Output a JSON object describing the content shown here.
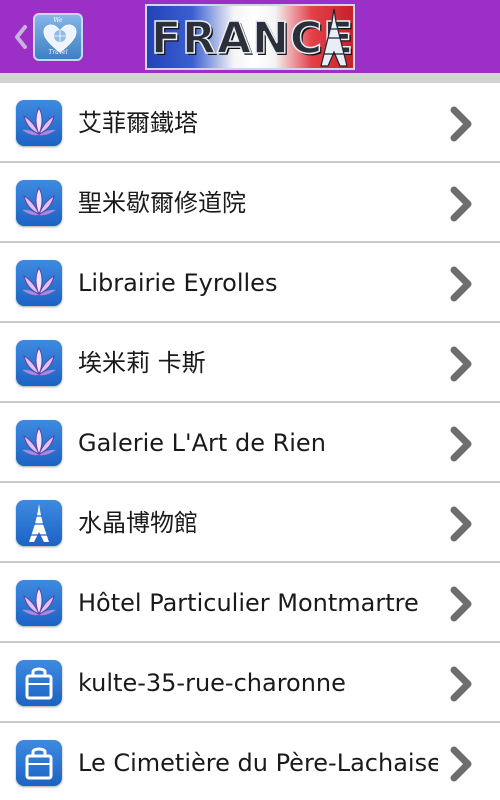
{
  "app_bar": {
    "background": "#9b2fc6",
    "back_icon": "chevron-left-icon",
    "logo": {
      "top_text": "We",
      "bottom_text": "Travel",
      "icon": "heart-globe-icon"
    },
    "title": "FRANCE",
    "title_icon": "eiffel-tower-icon"
  },
  "list": {
    "items": [
      {
        "label": "艾菲爾鐵塔",
        "icon": "lotus-icon"
      },
      {
        "label": "聖米歇爾修道院",
        "icon": "lotus-icon"
      },
      {
        "label": "Librairie Eyrolles",
        "icon": "lotus-icon"
      },
      {
        "label": "埃米莉 卡斯",
        "icon": "lotus-icon"
      },
      {
        "label": "Galerie L'Art de Rien",
        "icon": "lotus-icon"
      },
      {
        "label": "水晶博物館",
        "icon": "eiffel-tower-icon"
      },
      {
        "label": "Hôtel Particulier Montmartre",
        "icon": "lotus-icon"
      },
      {
        "label": "kulte-35-rue-charonne",
        "icon": "shopping-bag-icon"
      },
      {
        "label": "Le Cimetière du Père-Lachaise",
        "icon": "shopping-bag-icon"
      }
    ],
    "chevron_icon": "chevron-right-icon",
    "icon_color": "#1d62c4"
  }
}
